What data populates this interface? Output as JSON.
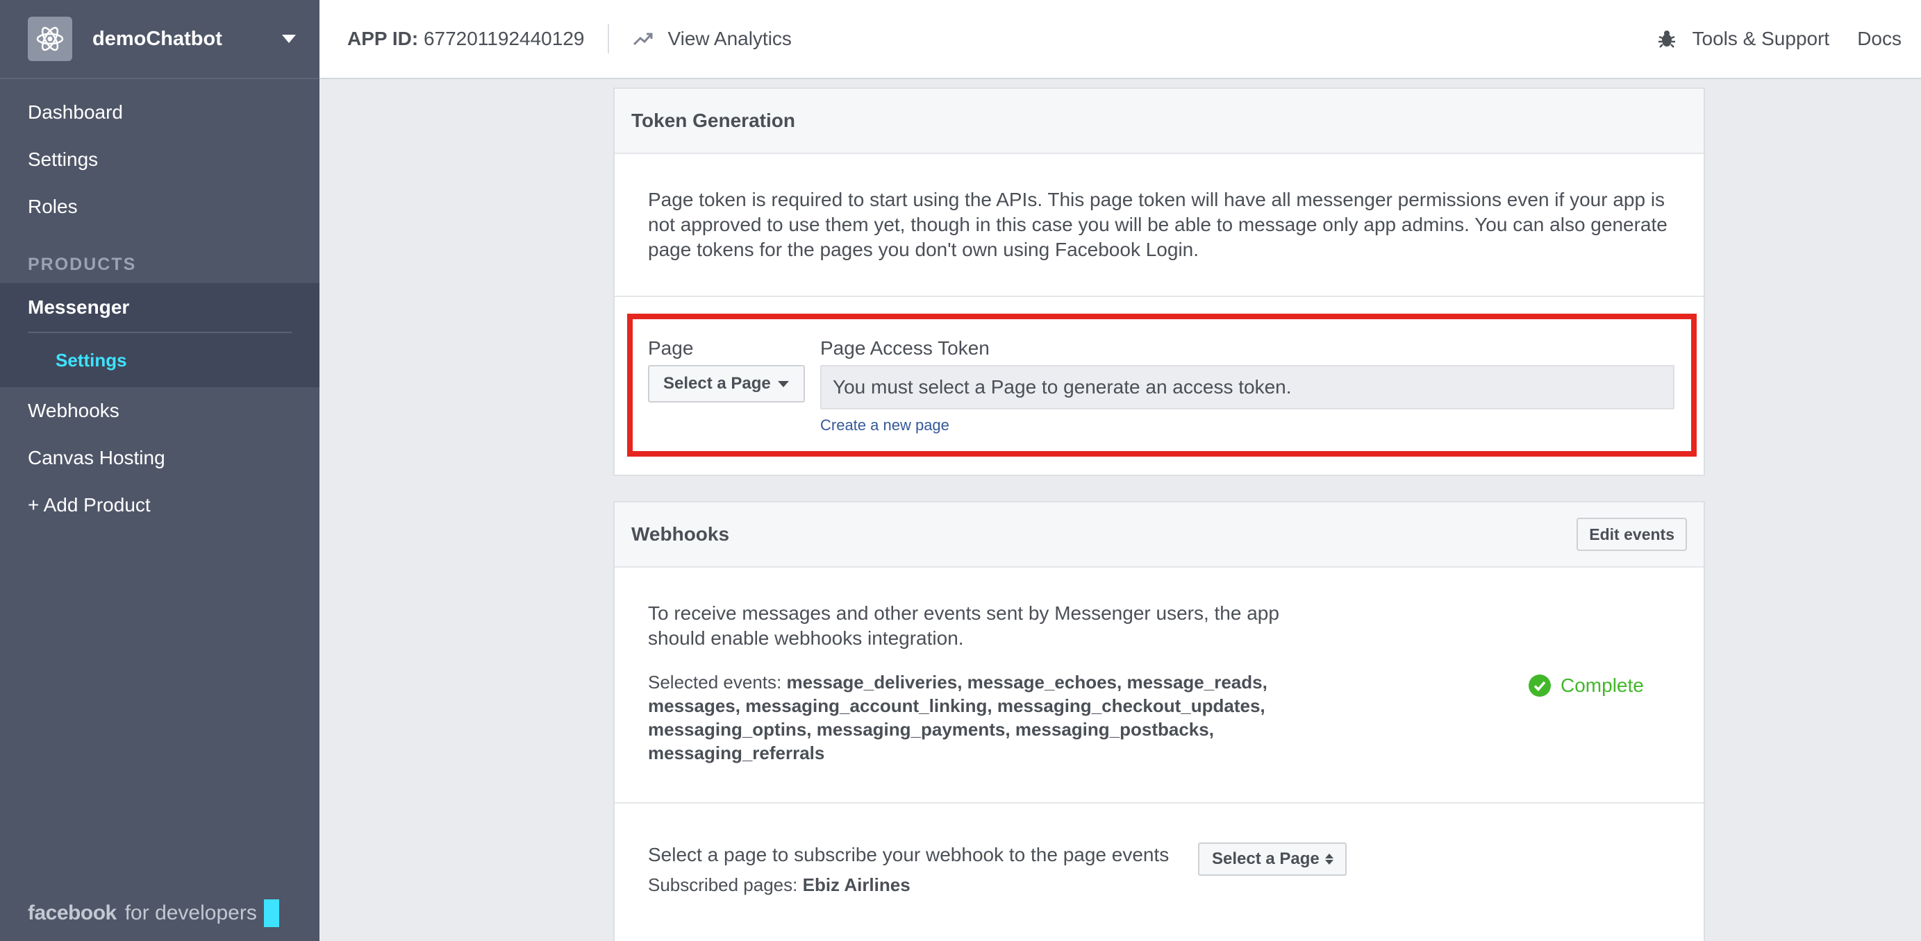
{
  "sidebar": {
    "app_name": "demoChatbot",
    "items_top": [
      "Dashboard",
      "Settings",
      "Roles"
    ],
    "products_title": "PRODUCTS",
    "messenger": {
      "label": "Messenger",
      "sub": "Settings"
    },
    "items_bottom": [
      "Webhooks",
      "Canvas Hosting",
      "+ Add Product"
    ],
    "brand": {
      "fb": "facebook",
      "dev": "for developers"
    }
  },
  "topbar": {
    "app_id_label": "APP ID:",
    "app_id_value": "677201192440129",
    "analytics": "View Analytics",
    "tools": "Tools & Support",
    "docs": "Docs"
  },
  "token_panel": {
    "title": "Token Generation",
    "description": "Page token is required to start using the APIs. This page token will have all messenger permissions even if your app is not approved to use them yet, though in this case you will be able to message only app admins. You can also generate page tokens for the pages you don't own using Facebook Login.",
    "page_label": "Page",
    "token_label": "Page Access Token",
    "select_page": "Select a Page",
    "token_placeholder": "You must select a Page to generate an access token.",
    "create_link": "Create a new page"
  },
  "webhooks_panel": {
    "title": "Webhooks",
    "edit_button": "Edit events",
    "description": "To receive messages and other events sent by Messenger users, the app should enable webhooks integration.",
    "events_label": "Selected events:",
    "events_value": "message_deliveries, message_echoes, message_reads, messages, messaging_account_linking, messaging_checkout_updates, messaging_optins, messaging_payments, messaging_postbacks, messaging_referrals",
    "status": "Complete",
    "subscribe_text": "Select a page to subscribe your webhook to the page events",
    "select_page": "Select a Page",
    "subscribed_label": "Subscribed pages:",
    "subscribed_value": "Ebiz Airlines"
  },
  "colors": {
    "sidebar_bg": "#4f5668",
    "active_sub": "#3ee3ff",
    "highlight_border": "#e5261f",
    "complete_green": "#42b72a",
    "link": "#365899"
  }
}
